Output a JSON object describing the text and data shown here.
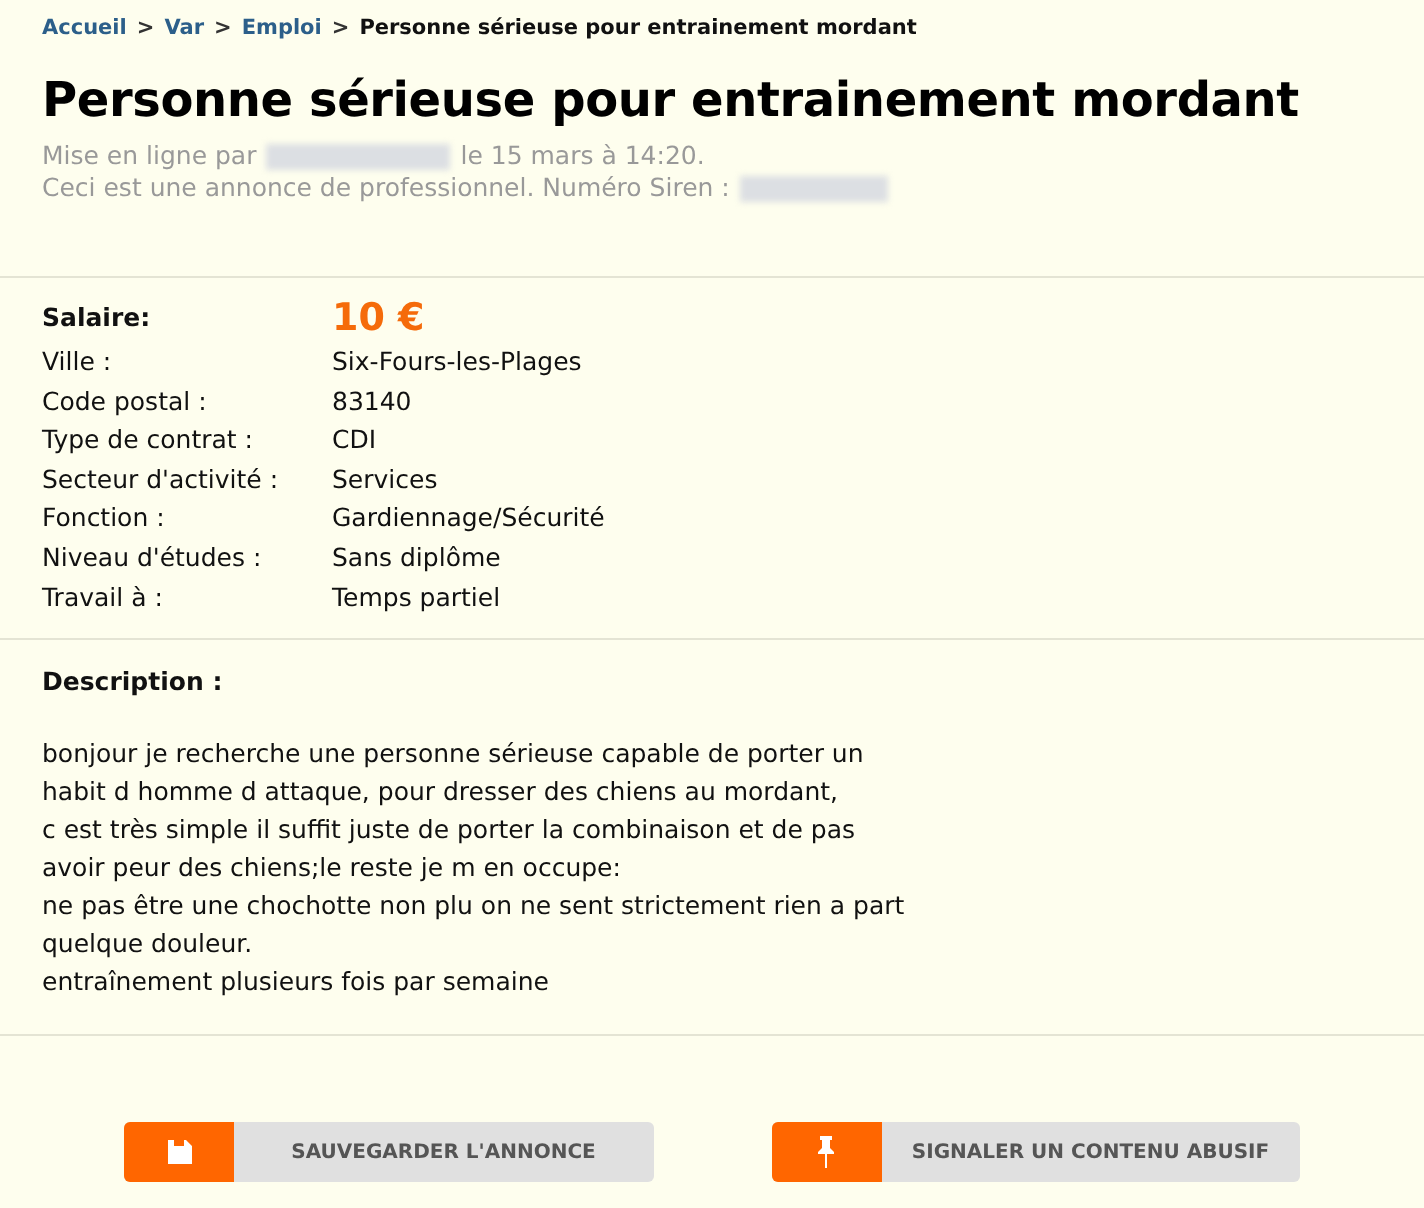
{
  "breadcrumb_separator": ">",
  "breadcrumb": [
    {
      "label": "Accueil",
      "kind": "link"
    },
    {
      "label": "Var",
      "kind": "link"
    },
    {
      "label": "Emploi",
      "kind": "link"
    },
    {
      "label": "Personne sérieuse pour entrainement mordant",
      "kind": "current"
    }
  ],
  "title": "Personne sérieuse pour entrainement mordant",
  "posted": {
    "prefix": "Mise en ligne par",
    "date": "le 15 mars à 14:20."
  },
  "professional": "Ceci est une annonce de professionnel. Numéro Siren :",
  "salary": {
    "label": "Salaire:",
    "value": "10 €"
  },
  "details": [
    {
      "label": "Ville :",
      "value": "Six-Fours-les-Plages"
    },
    {
      "label": "Code postal :",
      "value": "83140"
    },
    {
      "label": "Type de contrat :",
      "value": "CDI"
    },
    {
      "label": "Secteur d'activité :",
      "value": "Services"
    },
    {
      "label": "Fonction :",
      "value": "Gardiennage/Sécurité"
    },
    {
      "label": "Niveau d'études :",
      "value": "Sans diplôme"
    },
    {
      "label": "Travail à :",
      "value": "Temps partiel"
    }
  ],
  "description": {
    "heading": "Description :",
    "lines": [
      "bonjour je recherche une personne sérieuse capable de porter un",
      "habit d homme d attaque, pour dresser des chiens au mordant,",
      "c est très simple il suffit juste de porter la combinaison et de pas",
      "avoir peur des chiens;le reste je m en occupe:",
      "ne pas être une chochotte non plu on ne sent strictement rien a part",
      "quelque douleur.",
      "entraînement plusieurs fois par semaine"
    ]
  },
  "buttons": [
    {
      "label": "SAUVEGARDER L'ANNONCE",
      "kind": "save"
    },
    {
      "label": "SIGNALER UN CONTENU ABUSIF",
      "kind": "report"
    }
  ]
}
